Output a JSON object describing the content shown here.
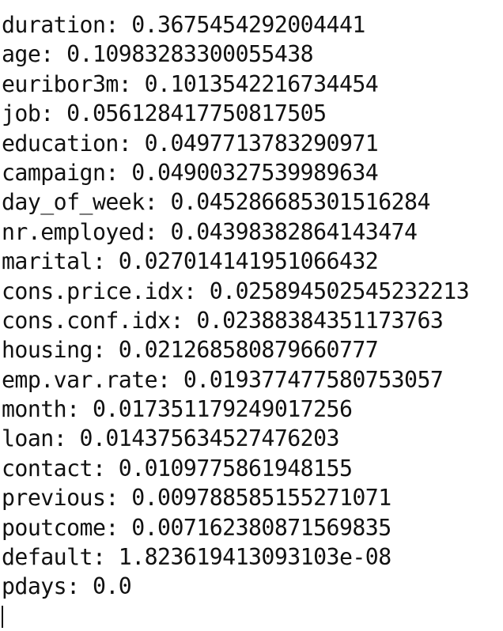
{
  "terminal": {
    "lines": [
      {
        "feature": "duration",
        "value": "0.3675454292004441"
      },
      {
        "feature": "age",
        "value": "0.10983283300055438"
      },
      {
        "feature": "euribor3m",
        "value": "0.1013542216734454"
      },
      {
        "feature": "job",
        "value": "0.056128417750817505"
      },
      {
        "feature": "education",
        "value": "0.0497713783290971"
      },
      {
        "feature": "campaign",
        "value": "0.04900327539989634"
      },
      {
        "feature": "day_of_week",
        "value": "0.045286685301516284"
      },
      {
        "feature": "nr.employed",
        "value": "0.04398382864143474"
      },
      {
        "feature": "marital",
        "value": "0.027014141951066432"
      },
      {
        "feature": "cons.price.idx",
        "value": "0.025894502545232213"
      },
      {
        "feature": "cons.conf.idx",
        "value": "0.02388384351173763"
      },
      {
        "feature": "housing",
        "value": "0.021268580879660777"
      },
      {
        "feature": "emp.var.rate",
        "value": "0.019377477580753057"
      },
      {
        "feature": "month",
        "value": "0.017351179249017256"
      },
      {
        "feature": "loan",
        "value": "0.014375634527476203"
      },
      {
        "feature": "contact",
        "value": "0.0109775861948155"
      },
      {
        "feature": "previous",
        "value": "0.009788585155271071"
      },
      {
        "feature": "poutcome",
        "value": "0.007162380871569835"
      },
      {
        "feature": "default",
        "value": "1.823619413093103e-08"
      },
      {
        "feature": "pdays",
        "value": "0.0"
      }
    ],
    "separator": ": "
  }
}
